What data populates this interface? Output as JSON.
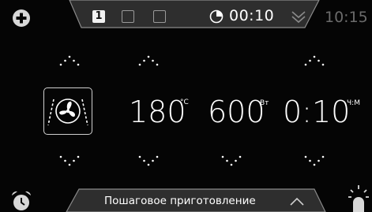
{
  "topbar": {
    "steps": [
      "1",
      "",
      ""
    ],
    "active_step_index": 0,
    "timer": "00:10",
    "clock": "10:15"
  },
  "settings": {
    "temperature": {
      "value": "180",
      "unit": "°C"
    },
    "power": {
      "value": "600",
      "unit": "Вт"
    },
    "time": {
      "value": "0:10",
      "unit": "Ч:М"
    }
  },
  "bottombar": {
    "label": "Пошаговое приготовление"
  },
  "icons": {
    "add": "plus-circle-icon",
    "timer": "pie-timer-icon",
    "collapse": "chevron-down-icon",
    "mode": "fan-heating-icon",
    "alarm": "alarm-clock-icon",
    "lamp": "lamp-icon",
    "expand": "chevron-up-icon"
  },
  "colors": {
    "background": "#050505",
    "bar": "#2e2e2e",
    "bar_outline": "#8a8a8a",
    "text": "#ffffff",
    "muted": "#6b6b6b"
  }
}
